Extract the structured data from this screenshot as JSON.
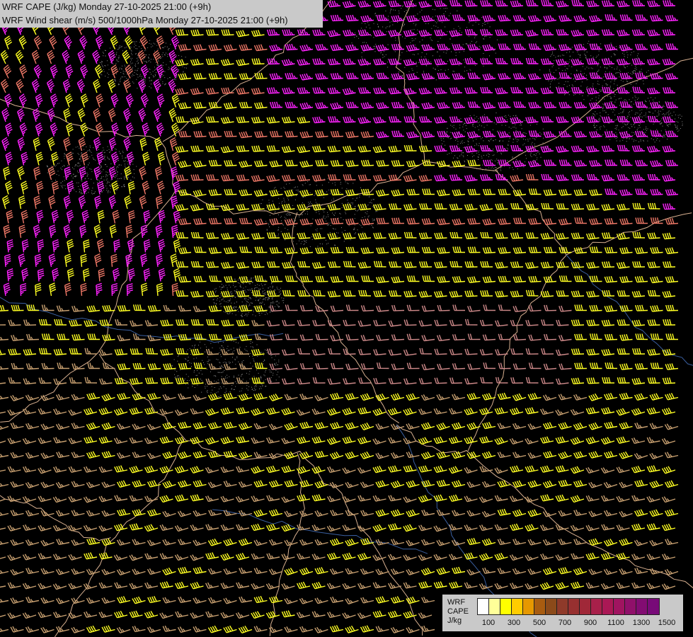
{
  "title": {
    "line1": "WRF CAPE (J/kg) Monday 27-10-2025 21:00 (+9h)",
    "line2": "WRF Wind shear (m/s) 500/1000hPa Monday 27-10-2025 21:00 (+9h)"
  },
  "legend": {
    "name_model": "WRF",
    "name_field": "CAPE",
    "unit": "J/kg",
    "colors": [
      "#ffffff",
      "#ffff99",
      "#ffff00",
      "#ffcc00",
      "#e69800",
      "#a85c10",
      "#8b4a1a",
      "#8f3a2a",
      "#973030",
      "#a02838",
      "#a8204a",
      "#aa1855",
      "#a01460",
      "#90106a",
      "#820c72",
      "#780a78"
    ],
    "ticks": [
      "100",
      "300",
      "500",
      "700",
      "900",
      "1100",
      "1300",
      "1500"
    ]
  },
  "barb_colors": {
    "magenta": "#ff22ff",
    "yellow": "#ffff22",
    "salmon": "#ee7766",
    "tan": "#c8a070",
    "pink": "#cc8888"
  },
  "boundary_colors": {
    "border": "#d8b090",
    "river": "#3a5fa0",
    "coast": "#bbbbbb"
  }
}
